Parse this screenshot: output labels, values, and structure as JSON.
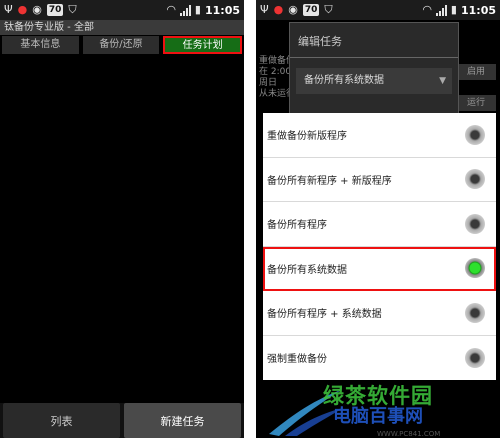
{
  "status_bar": {
    "battery": "70",
    "time": "11:05"
  },
  "left_screen": {
    "app_title": "钛备份专业版 - 全部",
    "tabs": [
      {
        "label": "基本信息"
      },
      {
        "label": "备份/还原"
      },
      {
        "label": "任务计划"
      }
    ],
    "bottom_buttons": [
      {
        "label": "列表"
      },
      {
        "label": "新建任务"
      }
    ]
  },
  "right_screen": {
    "background_rows": [
      "重做备份",
      "在 2:00",
      "周日",
      "从未运行"
    ],
    "background_side_buttons": [
      "启用",
      "运行"
    ],
    "edit_dialog": {
      "title": "编辑任务",
      "selected_value": "备份所有系统数据"
    },
    "options": [
      {
        "label": "重做备份新版程序",
        "checked": false
      },
      {
        "label": "备份所有新程序 + 新版程序",
        "checked": false
      },
      {
        "label": "备份所有程序",
        "checked": false
      },
      {
        "label": "备份所有系统数据",
        "checked": true
      },
      {
        "label": "备份所有程序 + 系统数据",
        "checked": false
      },
      {
        "label": "强制重做备份",
        "checked": false
      }
    ]
  },
  "watermark": {
    "brand": "绿茶软件园",
    "site": "电脑百事网",
    "url": "WWW.PC841.COM"
  },
  "colors": {
    "active_tab": "#166d16",
    "highlight_border": "#e11111",
    "radio_checked": "#2ee02e"
  }
}
